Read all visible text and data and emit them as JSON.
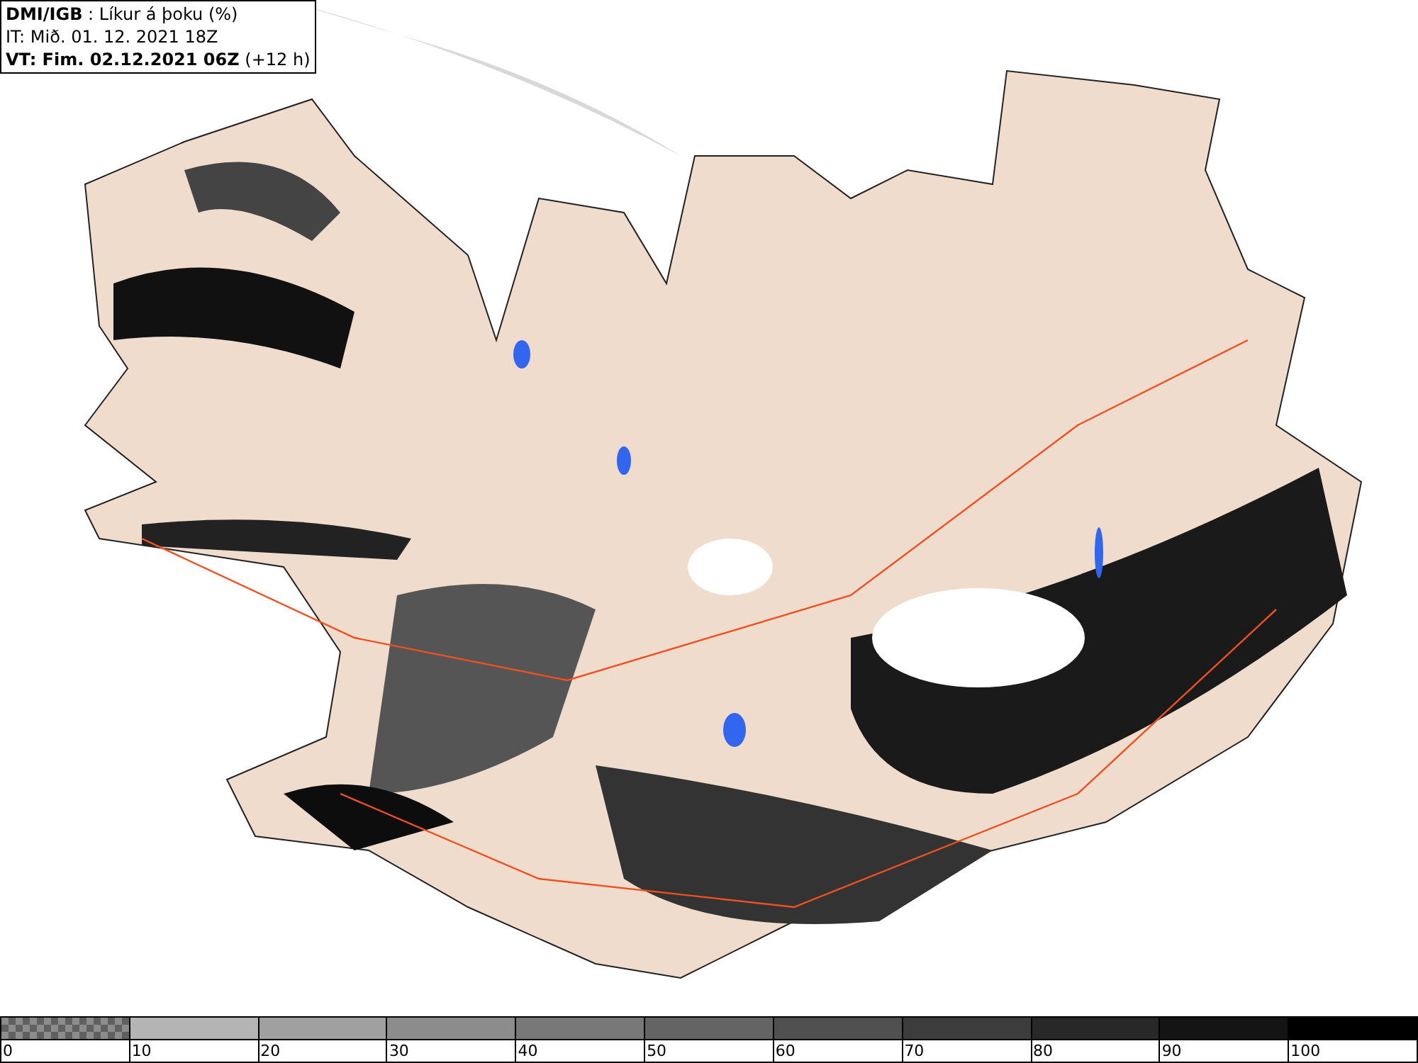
{
  "header": {
    "title": "**DMI/IGB** : Líkur á þoku (%)",
    "issue_time": "IT: Mið. 01. 12. 2021 18Z",
    "valid_time": "**VT: Fim. 02.12.2021 06Z** (+12 h)"
  },
  "legend": [
    {
      "kind": "pattern",
      "color": "#8c8c8c",
      "label": "0"
    },
    {
      "kind": "solid",
      "color": "#b4b4b4",
      "label": "10"
    },
    {
      "kind": "solid",
      "color": "#a0a0a0",
      "label": "20"
    },
    {
      "kind": "solid",
      "color": "#8c8c8c",
      "label": "30"
    },
    {
      "kind": "solid",
      "color": "#787878",
      "label": "40"
    },
    {
      "kind": "solid",
      "color": "#646464",
      "label": "50"
    },
    {
      "kind": "solid",
      "color": "#505050",
      "label": "60"
    },
    {
      "kind": "solid",
      "color": "#3c3c3c",
      "label": "70"
    },
    {
      "kind": "solid",
      "color": "#282828",
      "label": "80"
    },
    {
      "kind": "solid",
      "color": "#141414",
      "label": "90"
    },
    {
      "kind": "solid",
      "color": "#000000",
      "label": "100"
    }
  ]
}
